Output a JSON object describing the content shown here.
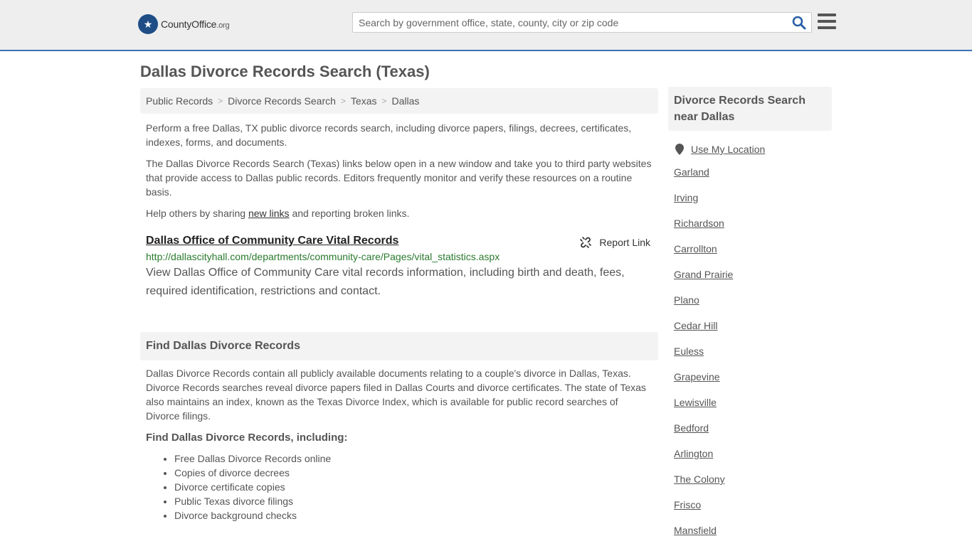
{
  "header": {
    "logo_main": "CountyOffice",
    "logo_suffix": ".org",
    "search_placeholder": "Search by government office, state, county, city or zip code"
  },
  "page": {
    "title": "Dallas Divorce Records Search (Texas)"
  },
  "breadcrumb": [
    "Public Records",
    "Divorce Records Search",
    "Texas",
    "Dallas"
  ],
  "intro": {
    "p1": "Perform a free Dallas, TX public divorce records search, including divorce papers, filings, decrees, certificates, indexes, forms, and documents.",
    "p2": "The Dallas Divorce Records Search (Texas) links below open in a new window and take you to third party websites that provide access to Dallas public records. Editors frequently monitor and verify these resources on a routine basis.",
    "p3_before": "Help others by sharing ",
    "p3_link": "new links",
    "p3_after": " and reporting broken links."
  },
  "listing": {
    "title": "Dallas Office of Community Care Vital Records",
    "report_label": "Report Link",
    "url": "http://dallascityhall.com/departments/community-care/Pages/vital_statistics.aspx",
    "description": "View Dallas Office of Community Care vital records information, including birth and death, fees, required identification, restrictions and contact."
  },
  "section": {
    "heading": "Find Dallas Divorce Records",
    "body": "Dallas Divorce Records contain all publicly available documents relating to a couple's divorce in Dallas, Texas. Divorce Records searches reveal divorce papers filed in Dallas Courts and divorce certificates. The state of Texas also maintains an index, known as the Texas Divorce Index, which is available for public record searches of Divorce filings.",
    "subheading": "Find Dallas Divorce Records, including:",
    "items": [
      "Free Dallas Divorce Records online",
      "Copies of divorce decrees",
      "Divorce certificate copies",
      "Public Texas divorce filings",
      "Divorce background checks"
    ]
  },
  "sidebar": {
    "heading": "Divorce Records Search near Dallas",
    "use_location": "Use My Location",
    "cities": [
      "Garland",
      "Irving",
      "Richardson",
      "Carrollton",
      "Grand Prairie",
      "Plano",
      "Cedar Hill",
      "Euless",
      "Grapevine",
      "Lewisville",
      "Bedford",
      "Arlington",
      "The Colony",
      "Frisco",
      "Mansfield"
    ]
  },
  "colors": {
    "accent": "#3a72b4",
    "logo_badge": "#1f4e86",
    "url_green": "#2a7a2e"
  },
  "icons": [
    "eagle-logo-icon",
    "search-icon",
    "hamburger-menu-icon",
    "broken-link-icon",
    "map-pin-icon"
  ]
}
